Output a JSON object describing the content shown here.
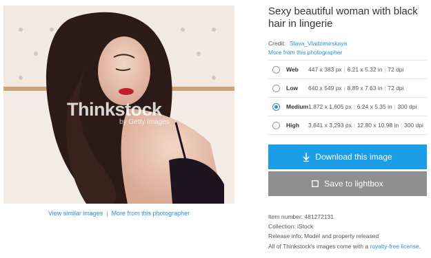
{
  "image": {
    "watermark_brand": "Thinkstock",
    "watermark_sub": "by Getty Images"
  },
  "under_links": {
    "similar": "View similar images",
    "separator": "|",
    "more": "More from this photographer"
  },
  "details": {
    "title": "Sexy beautiful woman with black hair in lingerie",
    "credit_label": "Credit:",
    "credit_name": "Slava_Vladzimirskaya",
    "more_link": "More from this photographer"
  },
  "sizes": [
    {
      "name": "Web",
      "px": "447 x 383 px",
      "inches": "6.21 x 5.32 in",
      "dpi": "72 dpi",
      "selected": false
    },
    {
      "name": "Low",
      "px": "640 x 549 px",
      "inches": "8.89 x 7.63 in",
      "dpi": "72 dpi",
      "selected": false
    },
    {
      "name": "Medium",
      "px": "1,872 x 1,605 px",
      "inches": "6.24 x 5.35 in",
      "dpi": "300 dpi",
      "selected": true
    },
    {
      "name": "High",
      "px": "3,841 x 3,293 px",
      "inches": "12.80 x 10.98 in",
      "dpi": "300 dpi",
      "selected": false
    }
  ],
  "buttons": {
    "download": "Download this image",
    "download_icon": "download-arrow-icon",
    "lightbox": "Save to lightbox",
    "lightbox_icon": "checkbox-icon"
  },
  "meta": {
    "item_number": "Item number:  481272131",
    "collection": "Collection:  iStock",
    "release": "Release info:  Model and property released",
    "license_prefix": "All of Thinkstock's images come with a ",
    "license_link": "royalty-free license",
    "license_suffix": "."
  },
  "colors": {
    "accent": "#2a8fd6",
    "download_bg": "#1a9ee8",
    "lightbox_bg": "#8f8f8f"
  }
}
